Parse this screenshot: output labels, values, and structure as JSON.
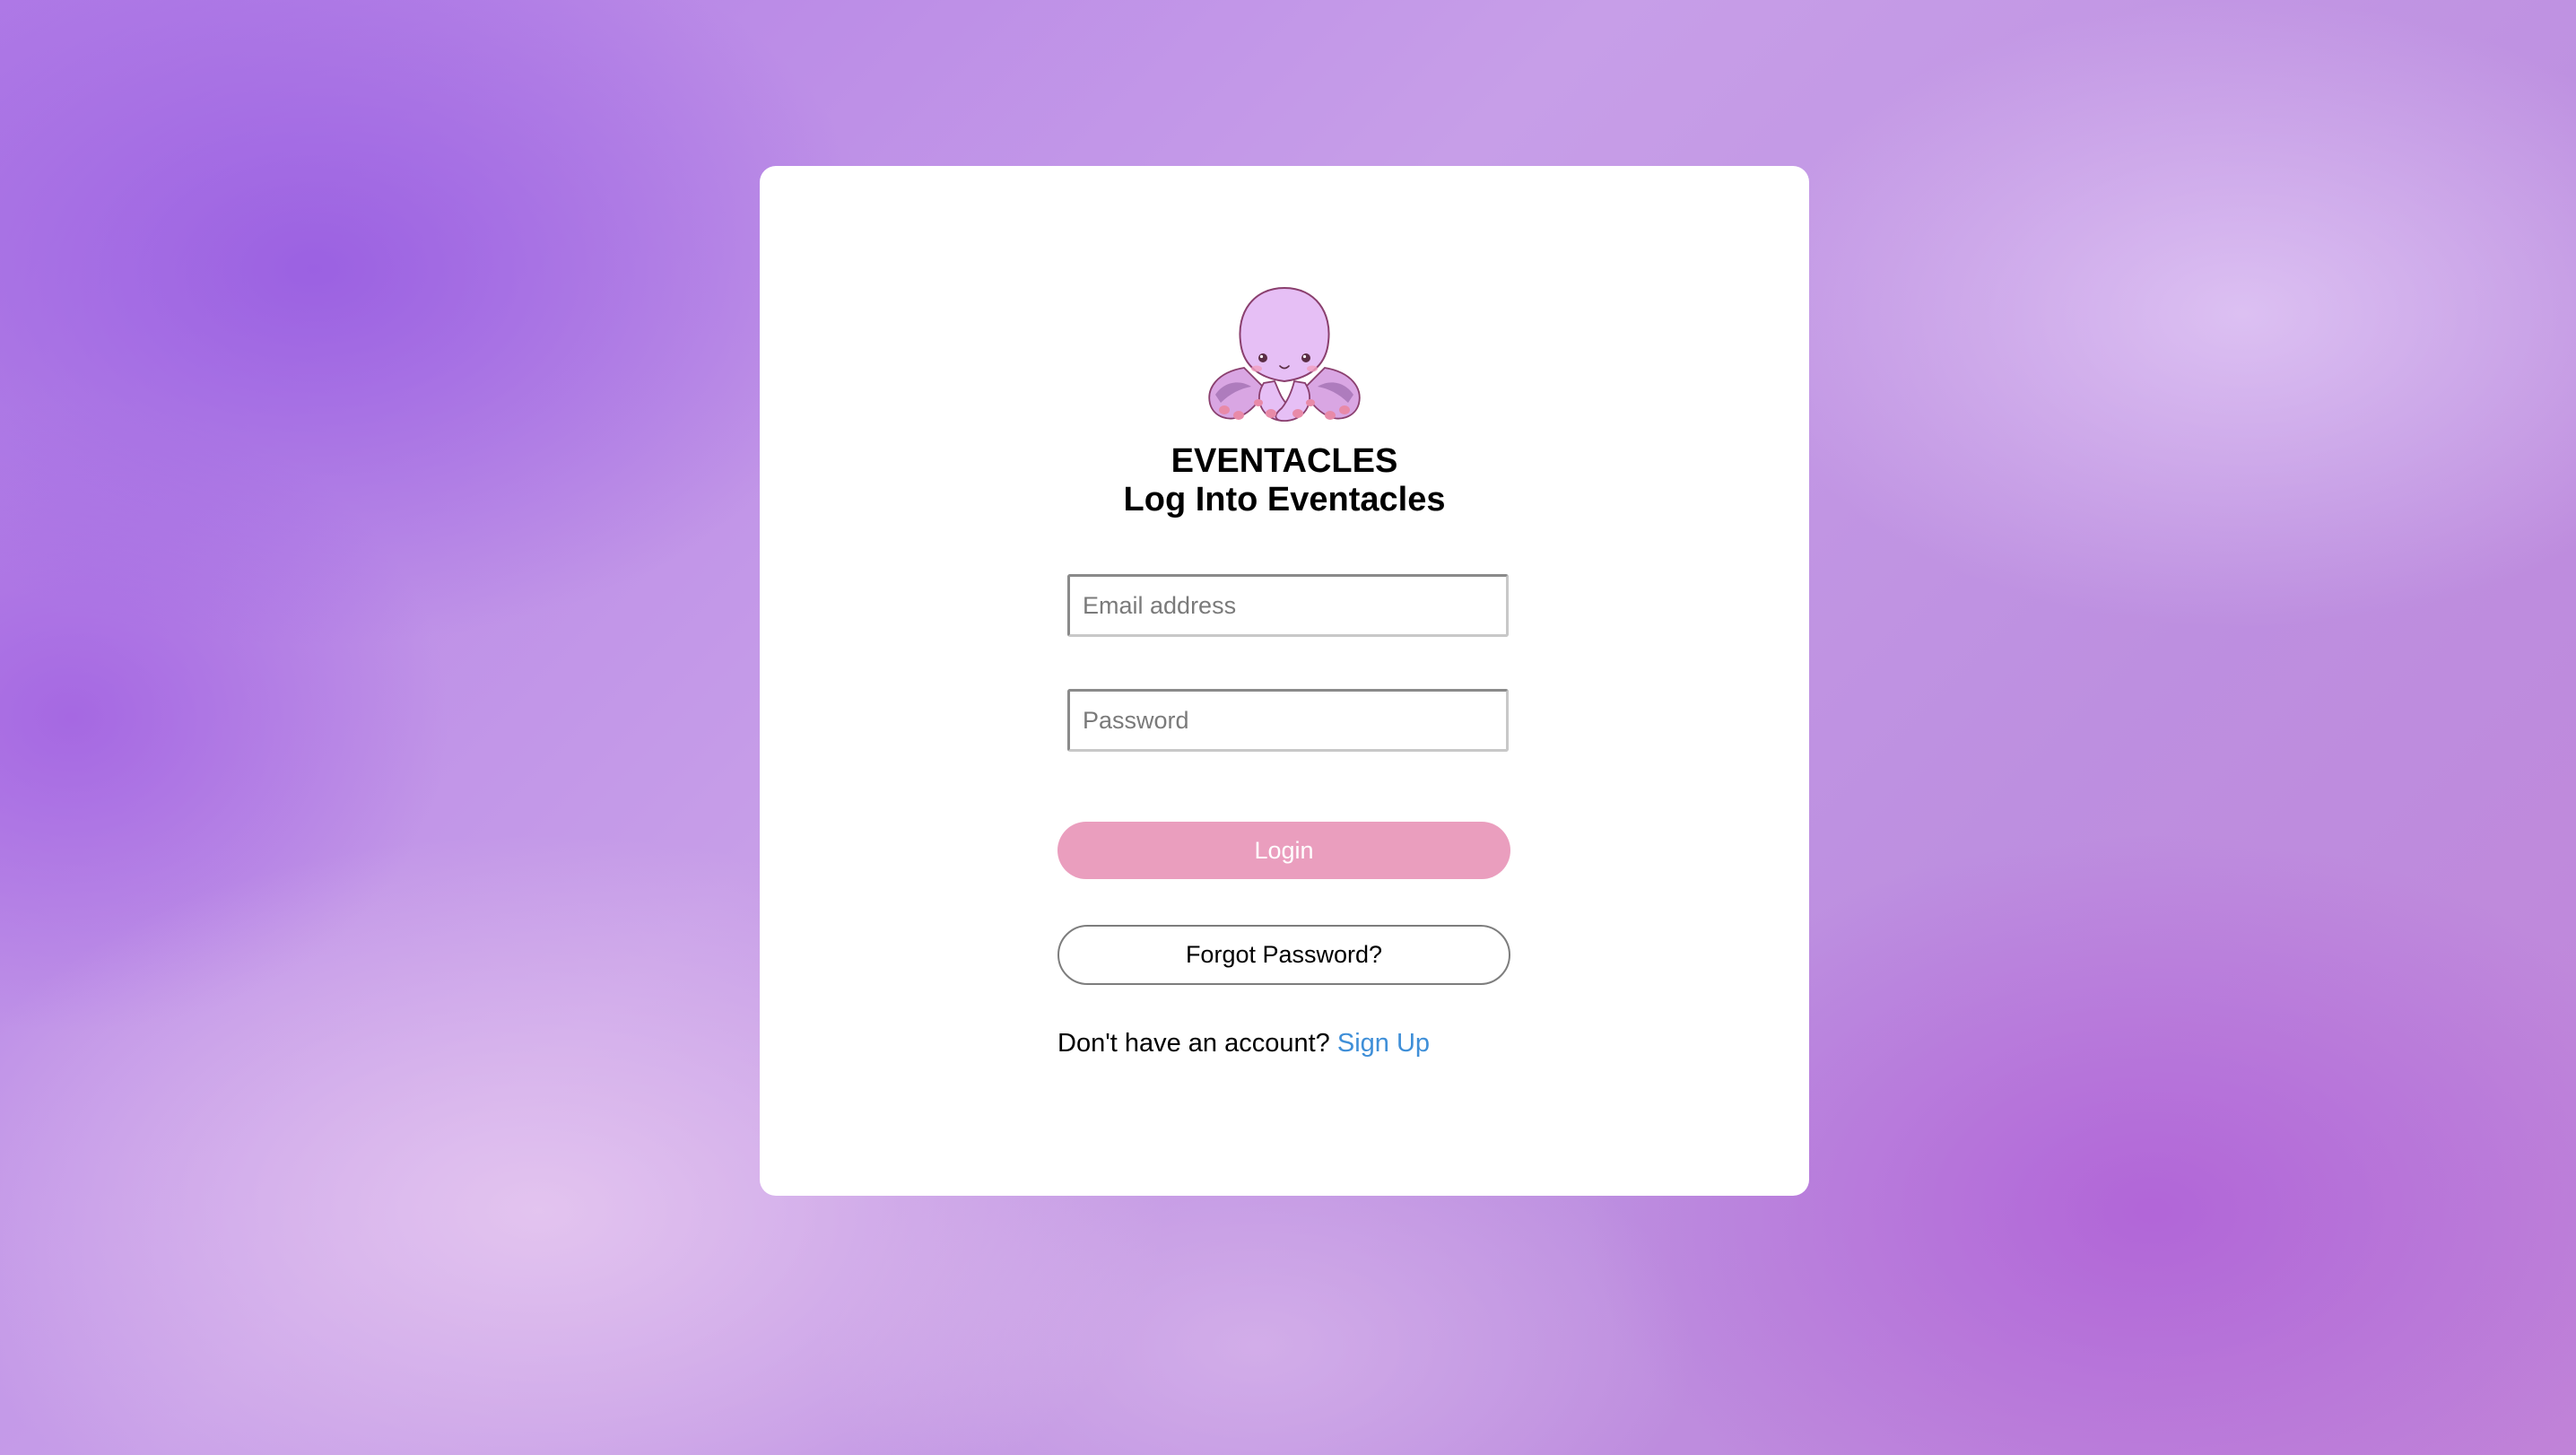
{
  "brand": {
    "name": "EVENTACLES",
    "logo_icon": "octopus-mascot-icon"
  },
  "login": {
    "heading": "Log Into Eventacles",
    "email_placeholder": "Email address",
    "password_placeholder": "Password",
    "login_label": "Login",
    "forgot_label": "Forgot Password?",
    "signup_prompt": "Don't have an account?",
    "signup_link": "Sign Up"
  },
  "colors": {
    "background": "#b07be6",
    "card": "#ffffff",
    "login_button": "#ea9ebe",
    "link": "#3f8fd8",
    "octopus_body": "#e6bff5",
    "octopus_outline": "#8a3f6e"
  }
}
